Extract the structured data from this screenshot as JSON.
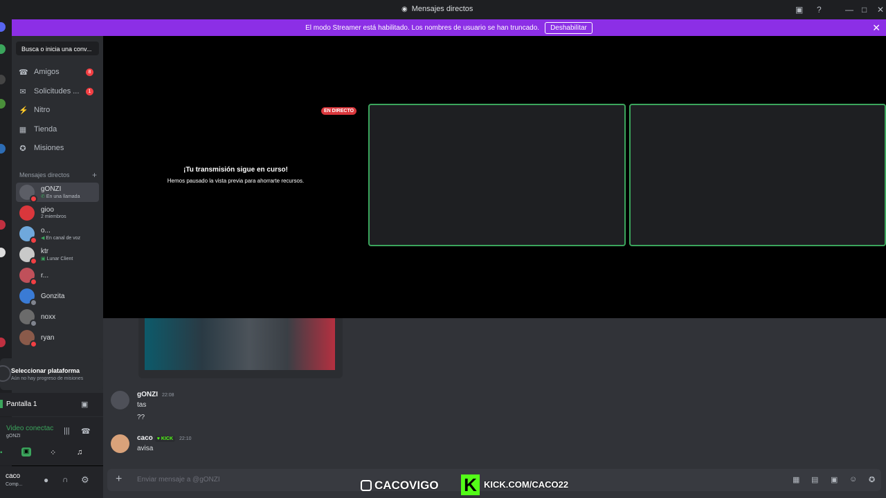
{
  "window": {
    "title": "Mensajes directos"
  },
  "streamer_banner": {
    "text": "El modo Streamer está habilitado. Los nombres de usuario se han truncado.",
    "button": "Deshabilitar"
  },
  "search": {
    "placeholder": "Busca o inicia una conv..."
  },
  "nav": [
    {
      "label": "Amigos",
      "icon": "friends-icon",
      "badge": "8"
    },
    {
      "label": "Solicitudes ...",
      "icon": "envelope-icon",
      "badge": "1"
    },
    {
      "label": "Nitro",
      "icon": "nitro-icon",
      "badge": ""
    },
    {
      "label": "Tienda",
      "icon": "store-icon",
      "badge": ""
    },
    {
      "label": "Misiones",
      "icon": "quests-icon",
      "badge": ""
    }
  ],
  "dm_header": "Mensajes directos",
  "dms": [
    {
      "name": "gONZI",
      "sub": "En una llamada",
      "color": "#5c5e66"
    },
    {
      "name": "gioo",
      "sub": "2 miembros",
      "color": "#da373c"
    },
    {
      "name": "o...",
      "sub": "En canal de voz",
      "color": "#6fa8dc"
    },
    {
      "name": "ktr",
      "sub": "Lunar Client",
      "color": "#c9c9c9"
    },
    {
      "name": "r...",
      "sub": "",
      "color": "#c0505a"
    },
    {
      "name": "Gonzita",
      "sub": "",
      "color": "#3a7bd5"
    },
    {
      "name": "noxx",
      "sub": "",
      "color": "#6b6b6b"
    },
    {
      "name": "ryan",
      "sub": "",
      "color": "#8a5a4a"
    }
  ],
  "quest": {
    "title": "Seleccionar plataforma",
    "sub": "Aún no hay progreso de misiones"
  },
  "screen_share": {
    "label": "Pantalla 1"
  },
  "voice": {
    "status": "Video conectac",
    "channel": "gONZI"
  },
  "user": {
    "name": "caco",
    "status": "Comp..."
  },
  "stream": {
    "live": "EN DIRECTO",
    "title": "¡Tu transmisión sigue en curso!",
    "subtitle": "Hemos pausado la vista previa para ahorrarte recursos."
  },
  "messages": [
    {
      "author": "gONZI",
      "time": "22:08",
      "lines": [
        "tas",
        "??"
      ]
    },
    {
      "author": "caco",
      "time": "22:10",
      "tag": "KICK",
      "lines": [
        "avisa"
      ]
    }
  ],
  "input": {
    "placeholder": "Enviar mensaje a @gONZI"
  },
  "overlay": {
    "instagram": "CACOVIGO",
    "kick": "KICK.COM/CACO22",
    "kick_logo": "K"
  }
}
